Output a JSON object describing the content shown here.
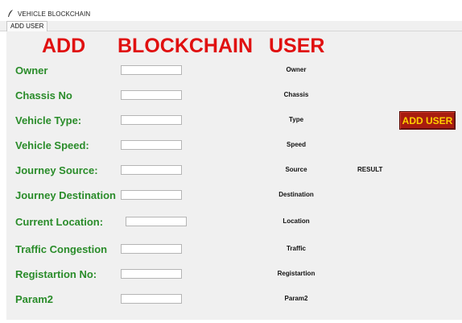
{
  "window": {
    "title": "VEHICLE BLOCKCHAIN",
    "icon": "feather-icon"
  },
  "tabs": [
    {
      "label": "ADD USER",
      "selected": true
    }
  ],
  "heading": {
    "words": [
      "ADD",
      "BLOCKCHAIN",
      "USER"
    ],
    "color": "#e01010"
  },
  "form": {
    "label_color": "#2a8c2a",
    "fields": [
      {
        "label": "Owner",
        "value": "",
        "output": "Owner"
      },
      {
        "label": "Chassis No",
        "value": "",
        "output": "Chassis"
      },
      {
        "label": "Vehicle Type:",
        "value": "",
        "output": "Type"
      },
      {
        "label": "Vehicle Speed:",
        "value": "",
        "output": "Speed"
      },
      {
        "label": "Journey Source:",
        "value": "",
        "output": "Source"
      },
      {
        "label": "Journey Destination",
        "value": "",
        "output": "Destination"
      },
      {
        "label": "Current Location:",
        "value": "",
        "output": "Location"
      },
      {
        "label": "Traffic Congestion",
        "value": "",
        "output": "Traffic"
      },
      {
        "label": "Registartion No:",
        "value": "",
        "output": "Registartion"
      },
      {
        "label": "Param2",
        "value": "",
        "output": "Param2"
      }
    ]
  },
  "result_label": "RESULT",
  "add_button": {
    "label": "ADD USER",
    "bg_color": "#a81c10",
    "text_color": "#ffd000"
  }
}
